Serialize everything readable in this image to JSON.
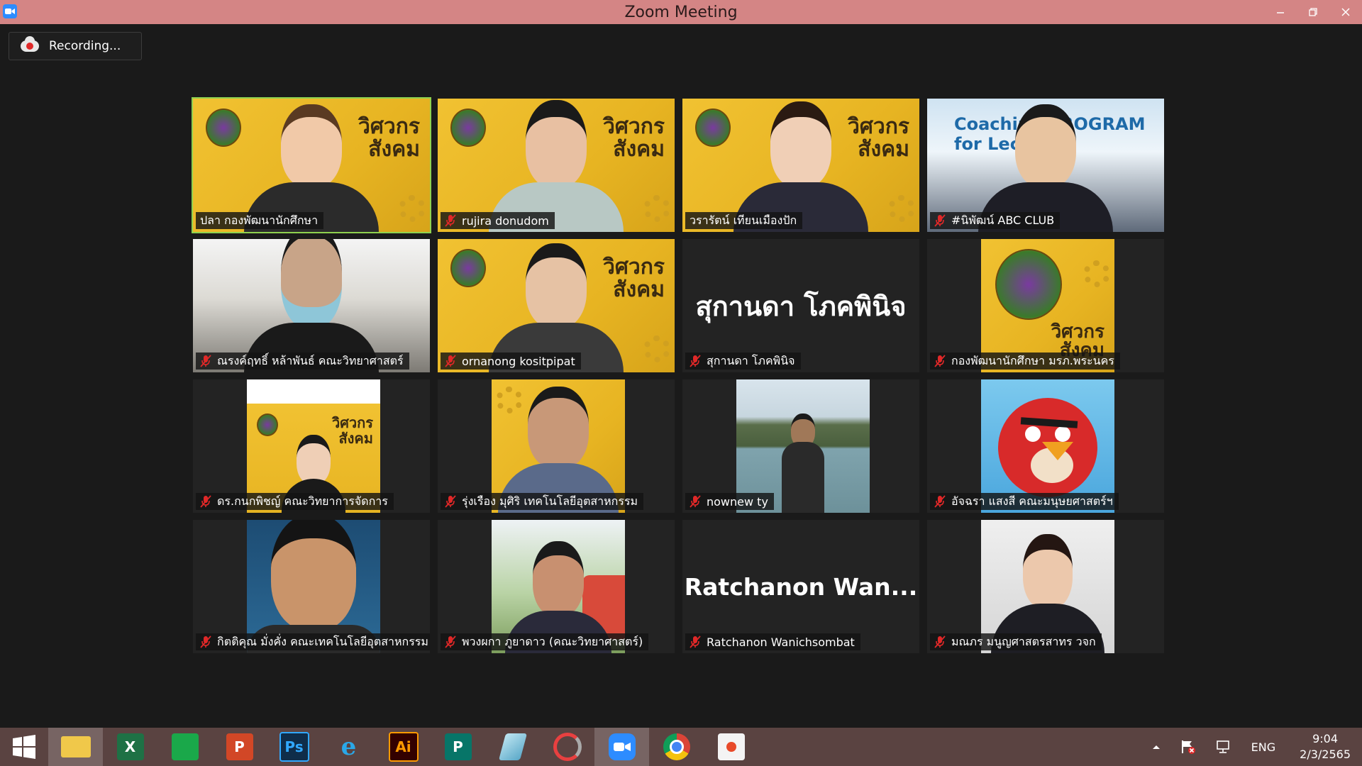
{
  "window": {
    "title": "Zoom Meeting"
  },
  "recording": {
    "label": "Recording..."
  },
  "participants": [
    {
      "name": "ปลา กองพัฒนานักศึกษา",
      "muted": false,
      "kind": "video"
    },
    {
      "name": "rujira donudom",
      "muted": true,
      "kind": "video"
    },
    {
      "name": "วรารัตน์ เทียนเมืองปัก",
      "muted": false,
      "kind": "video"
    },
    {
      "name": "#นิพัฒน์ ABC CLUB",
      "muted": true,
      "kind": "video",
      "overlay_text": "Coaching PROGRAM for Lecturer"
    },
    {
      "name": "ณรงค์ฤทธิ์ หล้าพันธ์ คณะวิทยาศาสตร์",
      "muted": true,
      "kind": "video"
    },
    {
      "name": "ornanong kositpipat",
      "muted": true,
      "kind": "video"
    },
    {
      "name": "สุกานดา โภคพินิจ",
      "muted": true,
      "kind": "name",
      "display": "สุกานดา โภคพินิจ"
    },
    {
      "name": "กองพัฒนานักศึกษา มรภ.พระนคร",
      "muted": true,
      "kind": "video"
    },
    {
      "name": "ดร.กนกพิชญ์ คณะวิทยาการจัดการ",
      "muted": true,
      "kind": "video"
    },
    {
      "name": "รุ่งเรือง มุศิริ เทคโนโลยีอุตสาหกรรม",
      "muted": true,
      "kind": "video"
    },
    {
      "name": "nownew ty",
      "muted": true,
      "kind": "video"
    },
    {
      "name": "อัจฉรา แสงสี คณะมนุษยศาสตร์ฯ",
      "muted": true,
      "kind": "video"
    },
    {
      "name": "กิตติคุณ มั่งคั่ง คณะเทคโนโลยีอุตสาหกรรม",
      "muted": true,
      "kind": "video"
    },
    {
      "name": "พวงผกา ภูยาดาว (คณะวิทยาศาสตร์)",
      "muted": true,
      "kind": "video"
    },
    {
      "name": "Ratchanon Wanichsombat",
      "muted": true,
      "kind": "name",
      "display": "Ratchanon  Wan..."
    },
    {
      "name": "มณภร มนูญศาสตรสาทร วจก",
      "muted": true,
      "kind": "video"
    }
  ],
  "poster_text": {
    "line1": "วิศวกร",
    "line2": "สังคม"
  },
  "taskbar": {
    "apps": [
      {
        "name": "file-explorer",
        "glyph": ""
      },
      {
        "name": "excel",
        "glyph": "X"
      },
      {
        "name": "store",
        "glyph": ""
      },
      {
        "name": "powerpoint",
        "glyph": "P"
      },
      {
        "name": "photoshop",
        "glyph": "Ps"
      },
      {
        "name": "internet-explorer",
        "glyph": "e"
      },
      {
        "name": "illustrator",
        "glyph": "Ai"
      },
      {
        "name": "publisher",
        "glyph": "P"
      },
      {
        "name": "eraser-app",
        "glyph": ""
      },
      {
        "name": "photoscape",
        "glyph": ""
      },
      {
        "name": "zoom",
        "glyph": ""
      },
      {
        "name": "chrome",
        "glyph": ""
      },
      {
        "name": "presentation-app",
        "glyph": ""
      }
    ],
    "tray": {
      "language": "ENG",
      "time": "9:04",
      "date": "2/3/2565"
    }
  },
  "colors": {
    "titlebar": "#d48585",
    "active_speaker": "#8fd14f",
    "muted_icon": "#e02828",
    "taskbar": "#5a4341"
  }
}
